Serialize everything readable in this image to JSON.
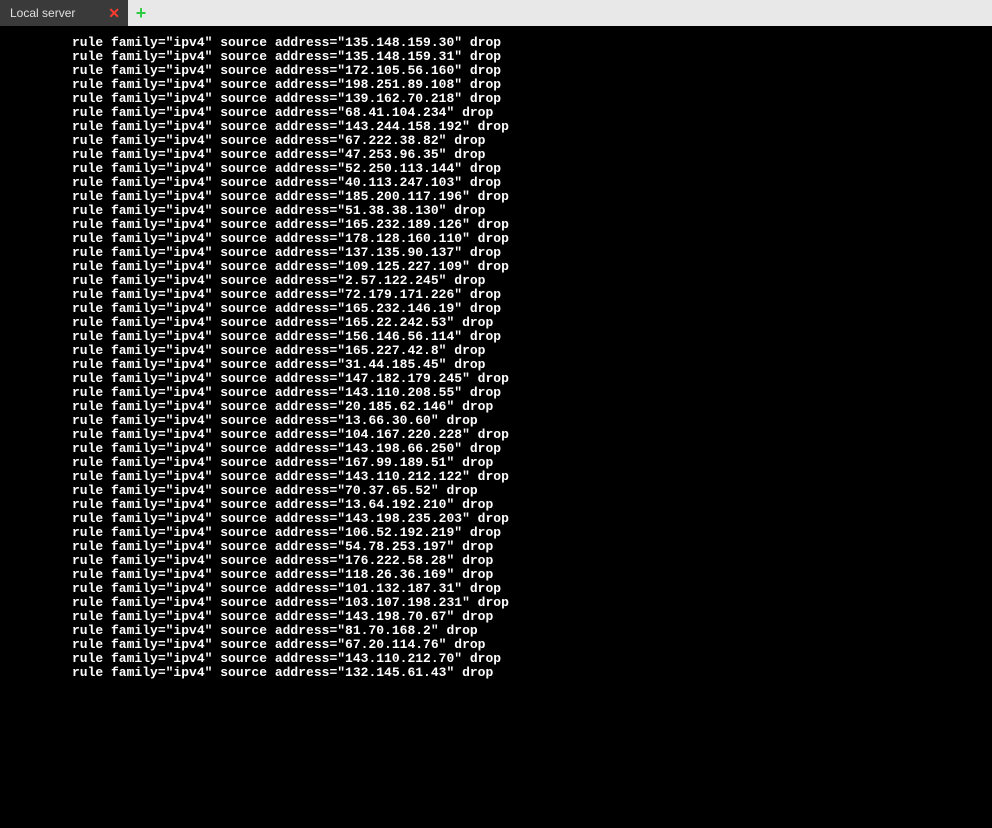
{
  "tabs": {
    "active": {
      "label": "Local server"
    }
  },
  "terminal": {
    "rule_template": "rule family=\"ipv4\" source address=\"{IP}\" drop",
    "ips": [
      "135.148.159.30",
      "135.148.159.31",
      "172.105.56.160",
      "198.251.89.108",
      "139.162.70.218",
      "68.41.104.234",
      "143.244.158.192",
      "67.222.38.82",
      "47.253.96.35",
      "52.250.113.144",
      "40.113.247.103",
      "185.200.117.196",
      "51.38.38.130",
      "165.232.189.126",
      "178.128.160.110",
      "137.135.90.137",
      "109.125.227.109",
      "2.57.122.245",
      "72.179.171.226",
      "165.232.146.19",
      "165.22.242.53",
      "156.146.56.114",
      "165.227.42.8",
      "31.44.185.45",
      "147.182.179.245",
      "143.110.208.55",
      "20.185.62.146",
      "13.66.30.60",
      "104.167.220.228",
      "143.198.66.250",
      "167.99.189.51",
      "143.110.212.122",
      "70.37.65.52",
      "13.64.192.210",
      "143.198.235.203",
      "106.52.192.219",
      "54.78.253.197",
      "176.222.58.28",
      "118.26.36.169",
      "101.132.187.31",
      "103.107.198.231",
      "143.198.70.67",
      "81.70.168.2",
      "67.20.114.76",
      "143.110.212.70",
      "132.145.61.43"
    ]
  }
}
